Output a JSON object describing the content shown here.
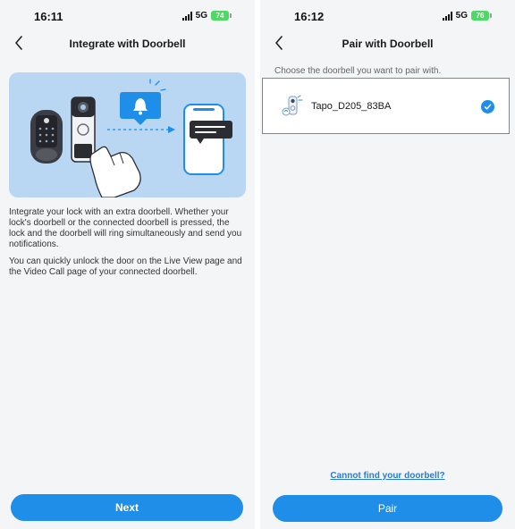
{
  "colors": {
    "accent": "#1f8ee8",
    "link": "#2a7cd3",
    "battery": "#4cd964",
    "selection_border": "#e06060",
    "screen_bg": "#f4f5f7",
    "hero_bg": "#b9d6f3"
  },
  "left_screen": {
    "status": {
      "time": "16:11",
      "network": "5G",
      "battery": "74"
    },
    "header": {
      "title": "Integrate with Doorbell",
      "back_icon": "chevron-left-icon"
    },
    "illustration": {
      "icons": [
        "smart-lock-icon",
        "doorbell-icon",
        "pointing-hand-icon",
        "bell-notification-icon",
        "phone-message-icon"
      ]
    },
    "description": [
      "Integrate your lock with an extra doorbell. Whether your lock's doorbell or the connected doorbell is pressed, the lock and the doorbell will ring simultaneously and send you notifications.",
      "You can quickly unlock the door on the Live View page and the Video Call page of your connected doorbell."
    ],
    "next_label": "Next"
  },
  "right_screen": {
    "status": {
      "time": "16:12",
      "network": "5G",
      "battery": "76"
    },
    "header": {
      "title": "Pair with Doorbell",
      "back_icon": "chevron-left-icon"
    },
    "instruction": "Choose the doorbell you want to pair with.",
    "devices": [
      {
        "name": "Tapo_D205_83BA",
        "icon": "doorbell-device-icon",
        "selected": true
      }
    ],
    "help_link": "Cannot find your doorbell?",
    "pair_label": "Pair"
  }
}
